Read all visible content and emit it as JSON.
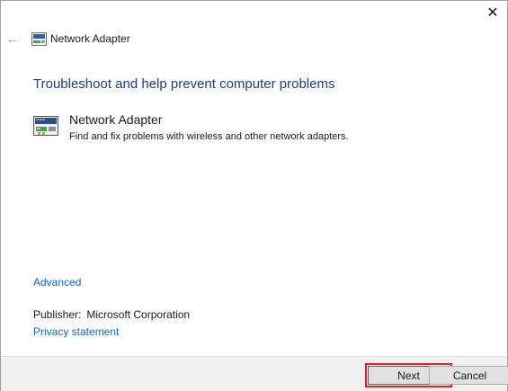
{
  "window": {
    "title": "Network Adapter",
    "close_glyph": "✕",
    "back_glyph": "←"
  },
  "main": {
    "heading": "Troubleshoot and help prevent computer problems",
    "item": {
      "title": "Network Adapter",
      "description": "Find and fix problems with wireless and other network adapters.",
      "icon": "network-adapter-icon"
    },
    "advanced_link": "Advanced",
    "publisher_label": "Publisher:",
    "publisher_value": "Microsoft Corporation",
    "privacy_link": "Privacy statement"
  },
  "footer": {
    "next_label": "Next",
    "cancel_label": "Cancel"
  },
  "colors": {
    "heading": "#1e3c8e",
    "link": "#1568b8",
    "footer_bg": "#f0f0f0",
    "highlight": "#e0202a",
    "focus": "#0078d7"
  }
}
